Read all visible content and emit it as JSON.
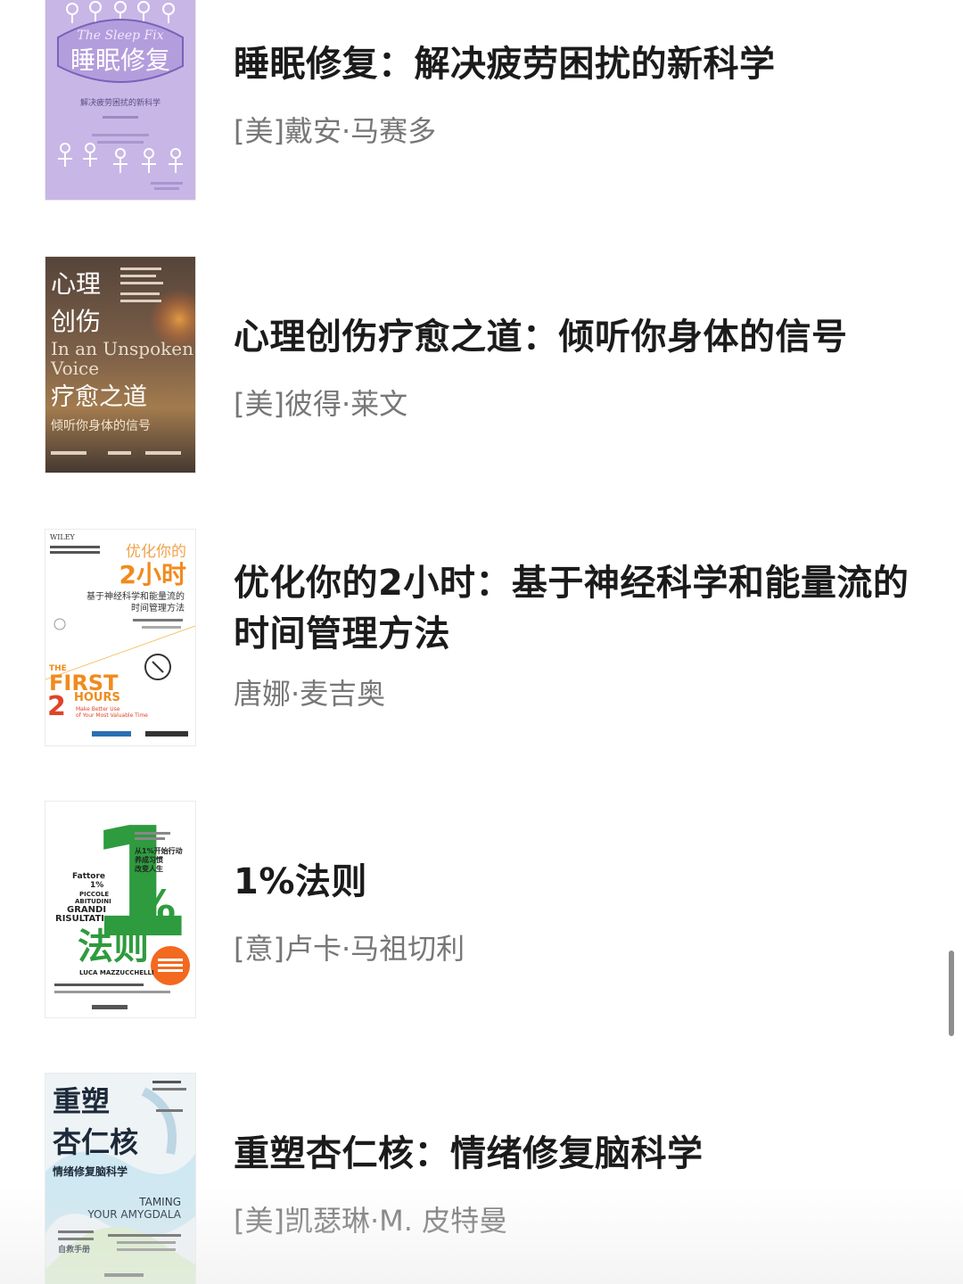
{
  "books": [
    {
      "title": "睡眠修复：解决疲劳困扰的新科学",
      "author": "[美]戴安·马赛多",
      "cover": {
        "bg": "#c8b6e6",
        "en_title": "The Sleep Fix",
        "cn_title": "睡眠修复",
        "subtitle": "解决疲劳困扰的新科学"
      }
    },
    {
      "title": "心理创伤疗愈之道：倾听你身体的信号",
      "author": "[美]彼得·莱文",
      "cover": {
        "bg": "#6e5a4a",
        "cn_line1": "心理",
        "cn_line2": "创伤",
        "en_line1": "In an Unspoken",
        "en_line2": "Voice",
        "cn_line3": "疗愈之道",
        "subtitle": "倾听你身体的信号"
      }
    },
    {
      "title": "优化你的2小时：基于神经科学和能量流的时间管理方法",
      "author": "唐娜·麦吉奥",
      "cover": {
        "bg": "#ffffff",
        "publisher": "WILEY",
        "cn_top": "优化你的",
        "cn_big": "2小时",
        "subtitle": "基于神经科学和能量流的",
        "subtitle2": "时间管理方法",
        "en_the": "THE",
        "en_first": "FIRST",
        "en_hours": "HOURS",
        "en_num": "2",
        "en_tag": "Make Better Use",
        "en_tag2": "of Your Most Valuable Time"
      }
    },
    {
      "title": "1%法则",
      "author": "[意]卢卡·马祖切利",
      "cover": {
        "bg": "#ffffff",
        "accent": "#2e9b3e",
        "big_one": "1",
        "percent": "%",
        "cn_title": "法则",
        "it_fattore": "Fattore",
        "it_pct": "1%",
        "it_piccole": "PICCOLE",
        "it_abitudini": "ABITUDINI",
        "it_grandi": "GRANDI",
        "it_risultati": "RISULTATI",
        "author_en": "LUCA MAZZUCCHELLI",
        "tag1": "从1%开始行动",
        "tag2": "养成习惯",
        "tag3": "改变人生"
      }
    },
    {
      "title": "重塑杏仁核：情绪修复脑科学",
      "author": "[美]凯瑟琳·M. 皮特曼",
      "cover": {
        "bg": "#eef3f6",
        "cn_line1": "重塑",
        "cn_line2": "杏仁核",
        "subtitle": "情绪修复脑科学",
        "en_line1": "TAMING",
        "en_line2": "YOUR AMYGDALA",
        "tag": "自救手册"
      }
    }
  ],
  "colors": {
    "title_text": "#1b1b1b",
    "author_text": "#777777",
    "scrollbar": "#8e8e8e"
  }
}
